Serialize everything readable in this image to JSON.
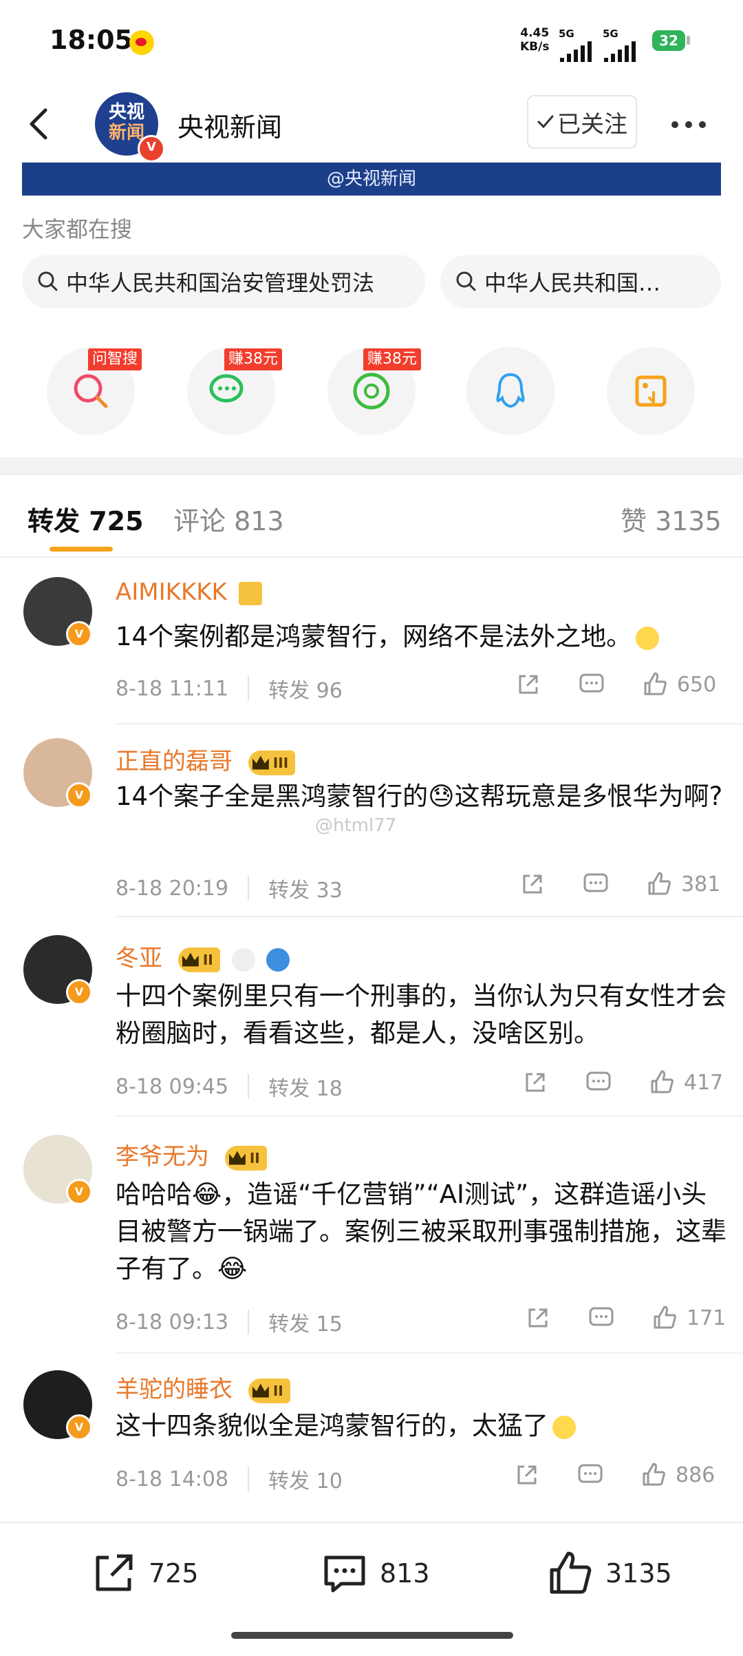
{
  "status_bar": {
    "time": "18:05",
    "net_speed_value": "4.45",
    "net_speed_unit": "KB/s",
    "signal1_label": "5G",
    "signal2_label": "5G",
    "battery": "32"
  },
  "header": {
    "account_name": "央视新闻",
    "avatar_text_line1": "央视",
    "avatar_text_line2": "新闻",
    "follow_label": "已关注"
  },
  "banner": {
    "text": "@央视新闻"
  },
  "search": {
    "hint": "大家都在搜",
    "chips": [
      "中华人民共和国治安管理处罚法",
      "中华人民共和国…"
    ]
  },
  "share_targets": [
    {
      "icon": "ai-search-icon",
      "tag": "问智搜",
      "color": "#ee4b6a"
    },
    {
      "icon": "wechat-icon",
      "tag": "赚38元",
      "color": "#2bbf5b"
    },
    {
      "icon": "moments-icon",
      "tag": "赚38元",
      "color": "#3dbb3d"
    },
    {
      "icon": "qq-icon",
      "tag": "",
      "color": "#2ea0ef"
    },
    {
      "icon": "save-image-icon",
      "tag": "",
      "color": "#f7a21b"
    }
  ],
  "tabs": {
    "repost": "转发 725",
    "comment": "评论 813",
    "like": "赞 3135"
  },
  "comments": [
    {
      "name": "AIMIKKKK",
      "badge": "",
      "text": "14个案例都是鸿蒙智行，网络不是法外之地。",
      "time": "8-18 11:11",
      "reposts": "转发 96",
      "likes": "650"
    },
    {
      "name": "正直的磊哥",
      "badge": "III",
      "text": "14个案子全是黑鸿蒙智行的😓这帮玩意是多恨华为啊?",
      "time": "8-18 20:19",
      "reposts": "转发 33",
      "likes": "381"
    },
    {
      "name": "冬亚",
      "badge": "II",
      "text": "十四个案例里只有一个刑事的，当你认为只有女性才会粉圈脑时，看看这些，都是人，没啥区别。",
      "time": "8-18 09:45",
      "reposts": "转发 18",
      "likes": "417"
    },
    {
      "name": "李爷无为",
      "badge": "II",
      "text": "哈哈哈😂，造谣“千亿营销”“AI测试”，这群造谣小头目被警方一锅端了。案例三被采取刑事强制措施，这辈子有了。😂",
      "time": "8-18 09:13",
      "reposts": "转发 15",
      "likes": "171"
    },
    {
      "name": "羊驼的睡衣",
      "badge": "II",
      "text": "这十四条貌似全是鸿蒙智行的，太猛了",
      "time": "8-18 14:08",
      "reposts": "转发 10",
      "likes": "886"
    }
  ],
  "watermark": "@html77",
  "bottom_bar": {
    "repost_count": "725",
    "comment_count": "813",
    "like_count": "3135"
  }
}
